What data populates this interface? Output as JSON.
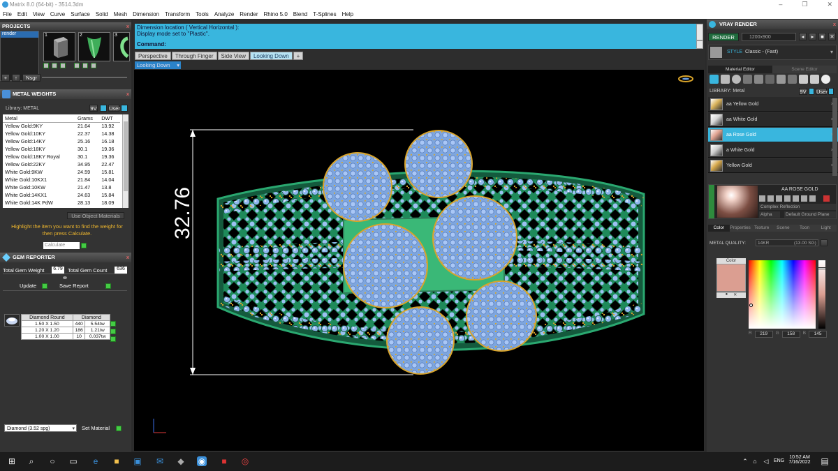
{
  "window": {
    "title": "Matrix 8.0 (64-bit) - 3514.3dm",
    "minimize": "–",
    "maximize": "❐",
    "close": "✕"
  },
  "menu": [
    "File",
    "Edit",
    "View",
    "Curve",
    "Surface",
    "Solid",
    "Mesh",
    "Dimension",
    "Transform",
    "Tools",
    "Analyze",
    "Render",
    "Rhino 5.0",
    "Blend",
    "T-Splines",
    "Help"
  ],
  "projects": {
    "title": "PROJECTS",
    "item": "render",
    "thumbs": [
      "1",
      "2",
      "3"
    ],
    "nbtns": [
      "+",
      "↑",
      "Nsgr"
    ]
  },
  "metal_weights": {
    "title": "METAL WEIGHTS",
    "library": "Library: METAL",
    "lib_btn1": "9V",
    "lib_btn2": "User",
    "headers": [
      "Metal",
      "Grams",
      "DWT"
    ],
    "rows": [
      [
        "Yellow Gold:9KY",
        "21.64",
        "13.92"
      ],
      [
        "Yellow Gold:10KY",
        "22.37",
        "14.38"
      ],
      [
        "Yellow Gold:14KY",
        "25.16",
        "16.18"
      ],
      [
        "Yellow Gold:18KY",
        "30.1",
        "19.36"
      ],
      [
        "Yellow Gold:18KY Royal",
        "30.1",
        "19.36"
      ],
      [
        "Yellow Gold:22KY",
        "34.95",
        "22.47"
      ],
      [
        "White Gold:9KW",
        "24.59",
        "15.81"
      ],
      [
        "White Gold:10KX1",
        "21.84",
        "14.04"
      ],
      [
        "White Gold:10KW",
        "21.47",
        "13.8"
      ],
      [
        "White Gold:14KX1",
        "24.63",
        "15.84"
      ],
      [
        "White Gold:14K PdW",
        "28.13",
        "18.09"
      ]
    ],
    "use_object_materials": "Use Object Materials",
    "hint": "Highlight the item you want to find the weight for then press Calculate.",
    "calculate": "Calculate"
  },
  "gem_reporter": {
    "title": "GEM REPORTER",
    "total_weight_label": "Total Gem Weight",
    "total_weight": "6.79",
    "total_count_label": "Total Gem Count",
    "total_count": "636",
    "update": "Update",
    "save_report": "Save Report",
    "headers": [
      "Diamond Round",
      "Diamond"
    ],
    "rows": [
      [
        "1.50 X 1.50",
        "440",
        "5.54tw"
      ],
      [
        "1.20 X 1.20",
        "186",
        "1.21tw"
      ],
      [
        "1.00 X 1.00",
        "10",
        "0.037tw"
      ]
    ],
    "gem_select": "Diamond   (3.52 spg)",
    "set_material": "Set Material"
  },
  "command": {
    "line1": "Dimension location ( Vertical  Horizontal ):",
    "line2": "Display mode set to \"Plastic\".",
    "prompt": "Command:"
  },
  "view_tabs": [
    "Perspective",
    "Through Finger",
    "Side View",
    "Looking Down",
    "+"
  ],
  "active_view": "Looking Down",
  "viewport": {
    "dimension": "32.76"
  },
  "vray": {
    "title": "VRAY RENDER",
    "render_btn": "RENDER",
    "resolution": "1200x900",
    "style_label": "STYLE",
    "style_value": "Classic - (Fast)",
    "tabs": [
      "Material Editor",
      "Scene Editor"
    ],
    "library": "LIBRARY: Metal",
    "lib_btn1": "9V",
    "lib_btn2": "User",
    "materials": [
      {
        "name": "aa Yellow Gold",
        "color": "#d9b25a"
      },
      {
        "name": "aa White Gold",
        "color": "#d8d8d8"
      },
      {
        "name": "aa Rose Gold",
        "color": "#e0a290"
      },
      {
        "name": "a White Gold",
        "color": "#cfcfcf"
      },
      {
        "name": "Yellow Gold",
        "color": "#d6a84a"
      }
    ],
    "selected_index": 2,
    "preview_title": "AA ROSE GOLD",
    "reflection": "Complex Reflection",
    "alpha": "Alpha",
    "ground": "Default Ground Plane",
    "subtabs": [
      "Color",
      "Properties",
      "Texture",
      "Scene",
      "Toon",
      "Light"
    ],
    "metal_quality_label": "METAL QUALITY:",
    "metal_quality": "14KR",
    "metal_quality_value": "(13.00 SG)",
    "color_label": "Color",
    "rgb": [
      "219",
      "158",
      "145"
    ],
    "swatch": "#db9e91"
  },
  "taskbar": {
    "time": "10:52 AM",
    "date": "7/16/2022",
    "lang": "ENG"
  },
  "colors": {
    "accent": "#39b6de",
    "ring": "#1e8a5a",
    "gem": "#8ab4ec",
    "prong": "#d9a42a"
  }
}
